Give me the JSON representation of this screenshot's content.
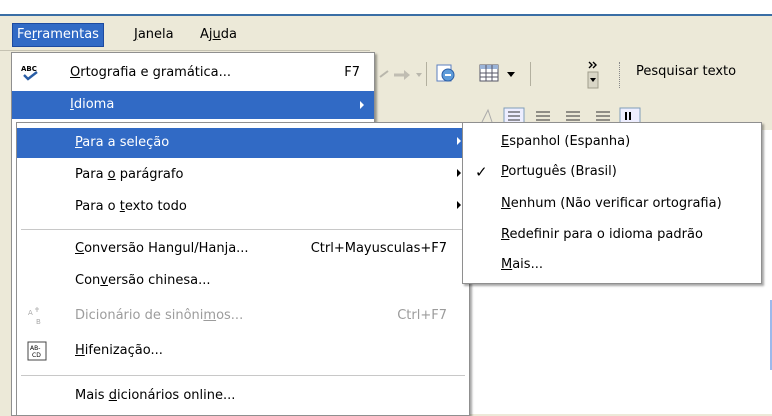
{
  "menubar": {
    "tools": {
      "pre": "Fe",
      "ul": "r",
      "post": "ramentas"
    },
    "window": {
      "pre": "",
      "ul": "J",
      "post": "anela"
    },
    "help": {
      "pre": "Aj",
      "ul": "u",
      "post": "da"
    }
  },
  "toolbar": {
    "search_label": "Pesquisar texto"
  },
  "tools_menu": {
    "spelling": {
      "pre": "",
      "ul": "O",
      "post": "rtografia e gramática...",
      "shortcut": "F7",
      "icon": "spellcheck-icon"
    },
    "language": {
      "pre": "",
      "ul": "I",
      "post": "dioma"
    }
  },
  "language_menu": {
    "for_selection": {
      "pre": "",
      "ul": "P",
      "post": "ara a seleção"
    },
    "for_paragraph": {
      "pre": "Para ",
      "ul": "o",
      "post": " parágrafo"
    },
    "for_all_text": {
      "pre": "Para o ",
      "ul": "t",
      "post": "exto todo"
    },
    "hangul": {
      "pre": "",
      "ul": "C",
      "post": "onversão Hangul/Hanja...",
      "shortcut": "Ctrl+Mayusculas+F7"
    },
    "chinese": {
      "pre": "Con",
      "ul": "v",
      "post": "ersão chinesa..."
    },
    "thesaurus": {
      "pre": "Dicionário de sinôni",
      "ul": "m",
      "post": "os...",
      "shortcut": "Ctrl+F7",
      "icon": "thesaurus-icon"
    },
    "hyphenation": {
      "pre": "",
      "ul": "H",
      "post": "ifenização...",
      "icon": "hyphenation-icon"
    },
    "more_dicts": {
      "pre": "Mais ",
      "ul": "d",
      "post": "icionários online..."
    }
  },
  "selection_menu": {
    "spanish": {
      "pre": "",
      "ul": "E",
      "post": "spanhol (Espanha)"
    },
    "portuguese": {
      "pre": "",
      "ul": "P",
      "post": "ortuguês (Brasil)",
      "checked": "✓"
    },
    "none": {
      "pre": "",
      "ul": "N",
      "post": "enhum (Não verificar ortografia)"
    },
    "reset": {
      "pre": "",
      "ul": "R",
      "post": "edefinir para o idioma padrão"
    },
    "more": {
      "pre": "",
      "ul": "M",
      "post": "ais..."
    }
  },
  "colors": {
    "highlight": "#316ac5",
    "menu_bg": "#ffffff",
    "chrome": "#ece9d8"
  }
}
